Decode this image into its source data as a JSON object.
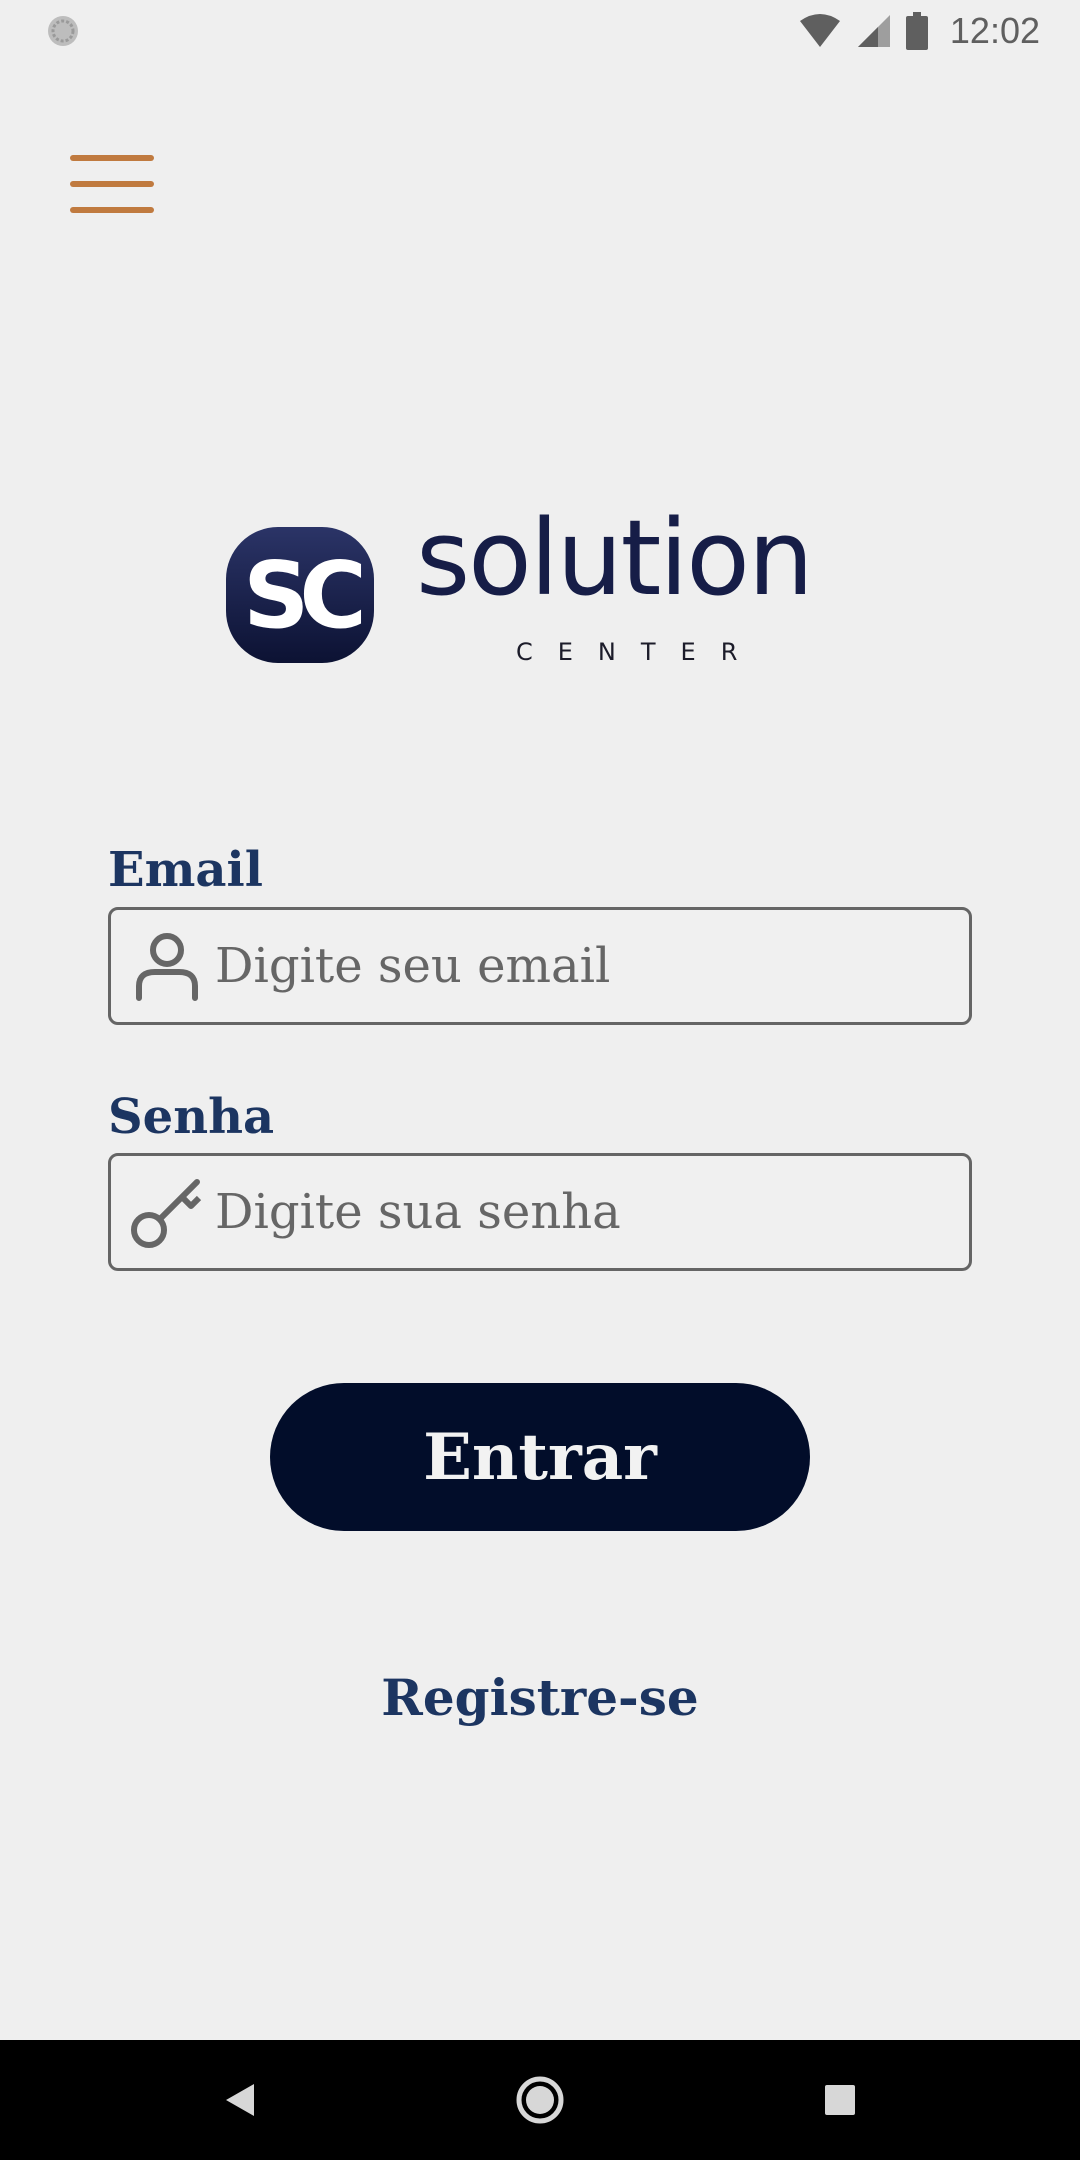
{
  "status_bar": {
    "time": "12:02",
    "icons": [
      "wifi-icon",
      "signal-icon",
      "battery-icon"
    ]
  },
  "menu": {
    "icon": "hamburger-menu-icon",
    "color": "#c07a3f"
  },
  "logo": {
    "mark": "SC",
    "name": "solution",
    "subtitle": "CENTER",
    "color": "#161d47"
  },
  "form": {
    "email": {
      "label": "Email",
      "placeholder": "Digite seu email",
      "value": "",
      "icon": "user-icon"
    },
    "password": {
      "label": "Senha",
      "placeholder": "Digite sua senha",
      "value": "",
      "icon": "key-icon"
    },
    "submit_label": "Entrar",
    "register_label": "Registre-se"
  },
  "colors": {
    "label": "#1c3561",
    "button_bg": "#020d2a",
    "background": "#efefef"
  },
  "nav_bar": {
    "buttons": [
      "back-icon",
      "home-icon",
      "recents-icon"
    ]
  }
}
